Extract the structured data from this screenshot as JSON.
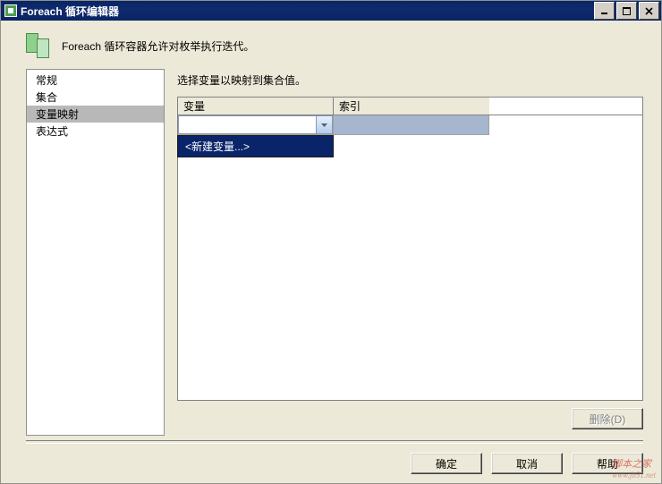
{
  "window": {
    "title": "Foreach 循环编辑器"
  },
  "header": {
    "description": "Foreach 循环容器允许对枚举执行迭代。"
  },
  "sidebar": {
    "items": [
      {
        "label": "常规",
        "selected": false
      },
      {
        "label": "集合",
        "selected": false
      },
      {
        "label": "变量映射",
        "selected": true
      },
      {
        "label": "表达式",
        "selected": false
      }
    ]
  },
  "main": {
    "instruction": "选择变量以映射到集合值。",
    "grid": {
      "columns": {
        "variable": "变量",
        "index": "索引"
      },
      "row": {
        "variable": "",
        "index": ""
      },
      "dropdown": {
        "new_variable": "<新建变量...>"
      }
    },
    "delete_label": "删除(D)"
  },
  "footer": {
    "ok": "确定",
    "cancel": "取消",
    "help": "帮助"
  },
  "watermark": {
    "line1": "脚本之家",
    "line2": "www.jb51.net"
  }
}
